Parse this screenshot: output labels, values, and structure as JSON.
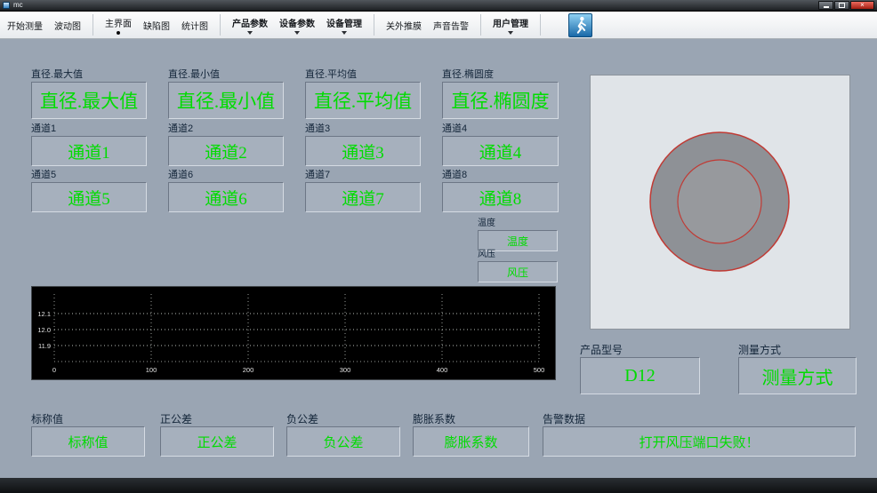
{
  "window": {
    "title": "mc"
  },
  "icons": {
    "close_glyph": "×"
  },
  "toolbar": {
    "start_measure": "开始测量",
    "wave_chart": "波动图",
    "main_screen": "主界面",
    "defect_chart": "缺陷图",
    "stats_chart": "统计图",
    "product_params": "产品参数",
    "device_params": "设备参数",
    "device_manage": "设备管理",
    "ext_push": "关外推膜",
    "sound_alarm": "声音告警",
    "user_manage": "用户管理"
  },
  "metrics": [
    {
      "label": "直径.最大值",
      "value": "直径.最大值"
    },
    {
      "label": "直径.最小值",
      "value": "直径.最小值"
    },
    {
      "label": "直径.平均值",
      "value": "直径.平均值"
    },
    {
      "label": "直径.椭圆度",
      "value": "直径.椭圆度"
    }
  ],
  "channels": [
    {
      "label": "通道1",
      "value": "通道1"
    },
    {
      "label": "通道2",
      "value": "通道2"
    },
    {
      "label": "通道3",
      "value": "通道3"
    },
    {
      "label": "通道4",
      "value": "通道4"
    },
    {
      "label": "通道5",
      "value": "通道5"
    },
    {
      "label": "通道6",
      "value": "通道6"
    },
    {
      "label": "通道7",
      "value": "通道7"
    },
    {
      "label": "通道8",
      "value": "通道8"
    }
  ],
  "aux": {
    "temperature": {
      "label": "温度",
      "value": "温度"
    },
    "pressure": {
      "label": "风压",
      "value": "风压"
    }
  },
  "product": {
    "label": "产品型号",
    "value": "D12"
  },
  "method": {
    "label": "测量方式",
    "value": "测量方式"
  },
  "bottom": [
    {
      "label": "标称值",
      "value": "标称值"
    },
    {
      "label": "正公差",
      "value": "正公差"
    },
    {
      "label": "负公差",
      "value": "负公差"
    },
    {
      "label": "膨胀系数",
      "value": "膨胀系数"
    }
  ],
  "alarm": {
    "label": "告警数据",
    "value": "打开风压端口失败！"
  },
  "chart_data": {
    "type": "line",
    "title": "",
    "y_ticks": [
      "12.1",
      "12.0",
      "11.9"
    ],
    "x_ticks": [
      "0",
      "100",
      "200",
      "300",
      "400",
      "500"
    ],
    "ylim": [
      11.85,
      12.15
    ],
    "xlim": [
      0,
      500
    ],
    "grid": "dotted",
    "series": []
  },
  "colors": {
    "value_green": "#00dc00",
    "page_bg": "#9aa5b3",
    "chart_bg": "#000000",
    "circle_stroke_red": "#c03a34"
  }
}
